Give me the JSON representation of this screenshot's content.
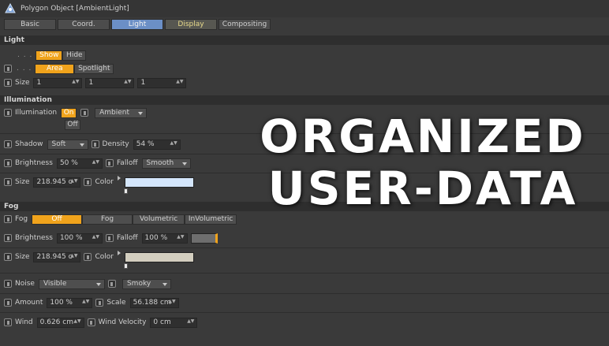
{
  "window": {
    "title": "Polygon Object [AmbientLight]"
  },
  "tabs": [
    "Basic",
    "Coord.",
    "Light",
    "Display",
    "Compositing"
  ],
  "light": {
    "header": "Light",
    "dots": ". . .",
    "show_label": "Show",
    "hide_label": "Hide",
    "area_label": "Area",
    "spotlight_label": "Spotlight",
    "size_label": "Size",
    "size_values": [
      "1",
      "1",
      "1"
    ]
  },
  "illumination": {
    "header": "Illumination",
    "label": "Illumination",
    "on_label": "On",
    "off_label": "Off",
    "mode": "Ambient",
    "shadow_label": "Shadow",
    "shadow_value": "Soft",
    "density_label": "Density",
    "density_value": "54 %",
    "brightness_label": "Brightness",
    "brightness_value": "50 %",
    "falloff_label": "Falloff",
    "falloff_value": "Smooth",
    "size_label": "Size",
    "size_value": "218.945 c",
    "color_label": "Color",
    "color": "#d4e6fb"
  },
  "fog": {
    "header": "Fog",
    "label": "Fog",
    "options": [
      "Off",
      "Fog",
      "Volumetric",
      "InVolumetric"
    ],
    "brightness_label": "Brightness",
    "brightness_value": "100 %",
    "falloff_label": "Falloff",
    "falloff_value": "100 %",
    "falloff_color": "#6e6e6e",
    "size_label": "Size",
    "size_value": "218.945 c",
    "color_label": "Color",
    "color": "#d3cebf",
    "noise_label": "Noise",
    "noise_value": "Visible",
    "noise_type": "Smoky",
    "amount_label": "Amount",
    "amount_value": "100 %",
    "scale_label": "Scale",
    "scale_value": "56.188 cm",
    "wind_label": "Wind",
    "wind_value": "0.626 cm",
    "wind_velocity_label": "Wind Velocity",
    "wind_velocity_value": "0 cm"
  },
  "overlay": {
    "line1": "ORGANIZED",
    "line2": "USER-DATA"
  },
  "colors": {
    "accent": "#f0a31c",
    "active_tab": "#6b8fc6",
    "panel": "#3a3a3a"
  }
}
